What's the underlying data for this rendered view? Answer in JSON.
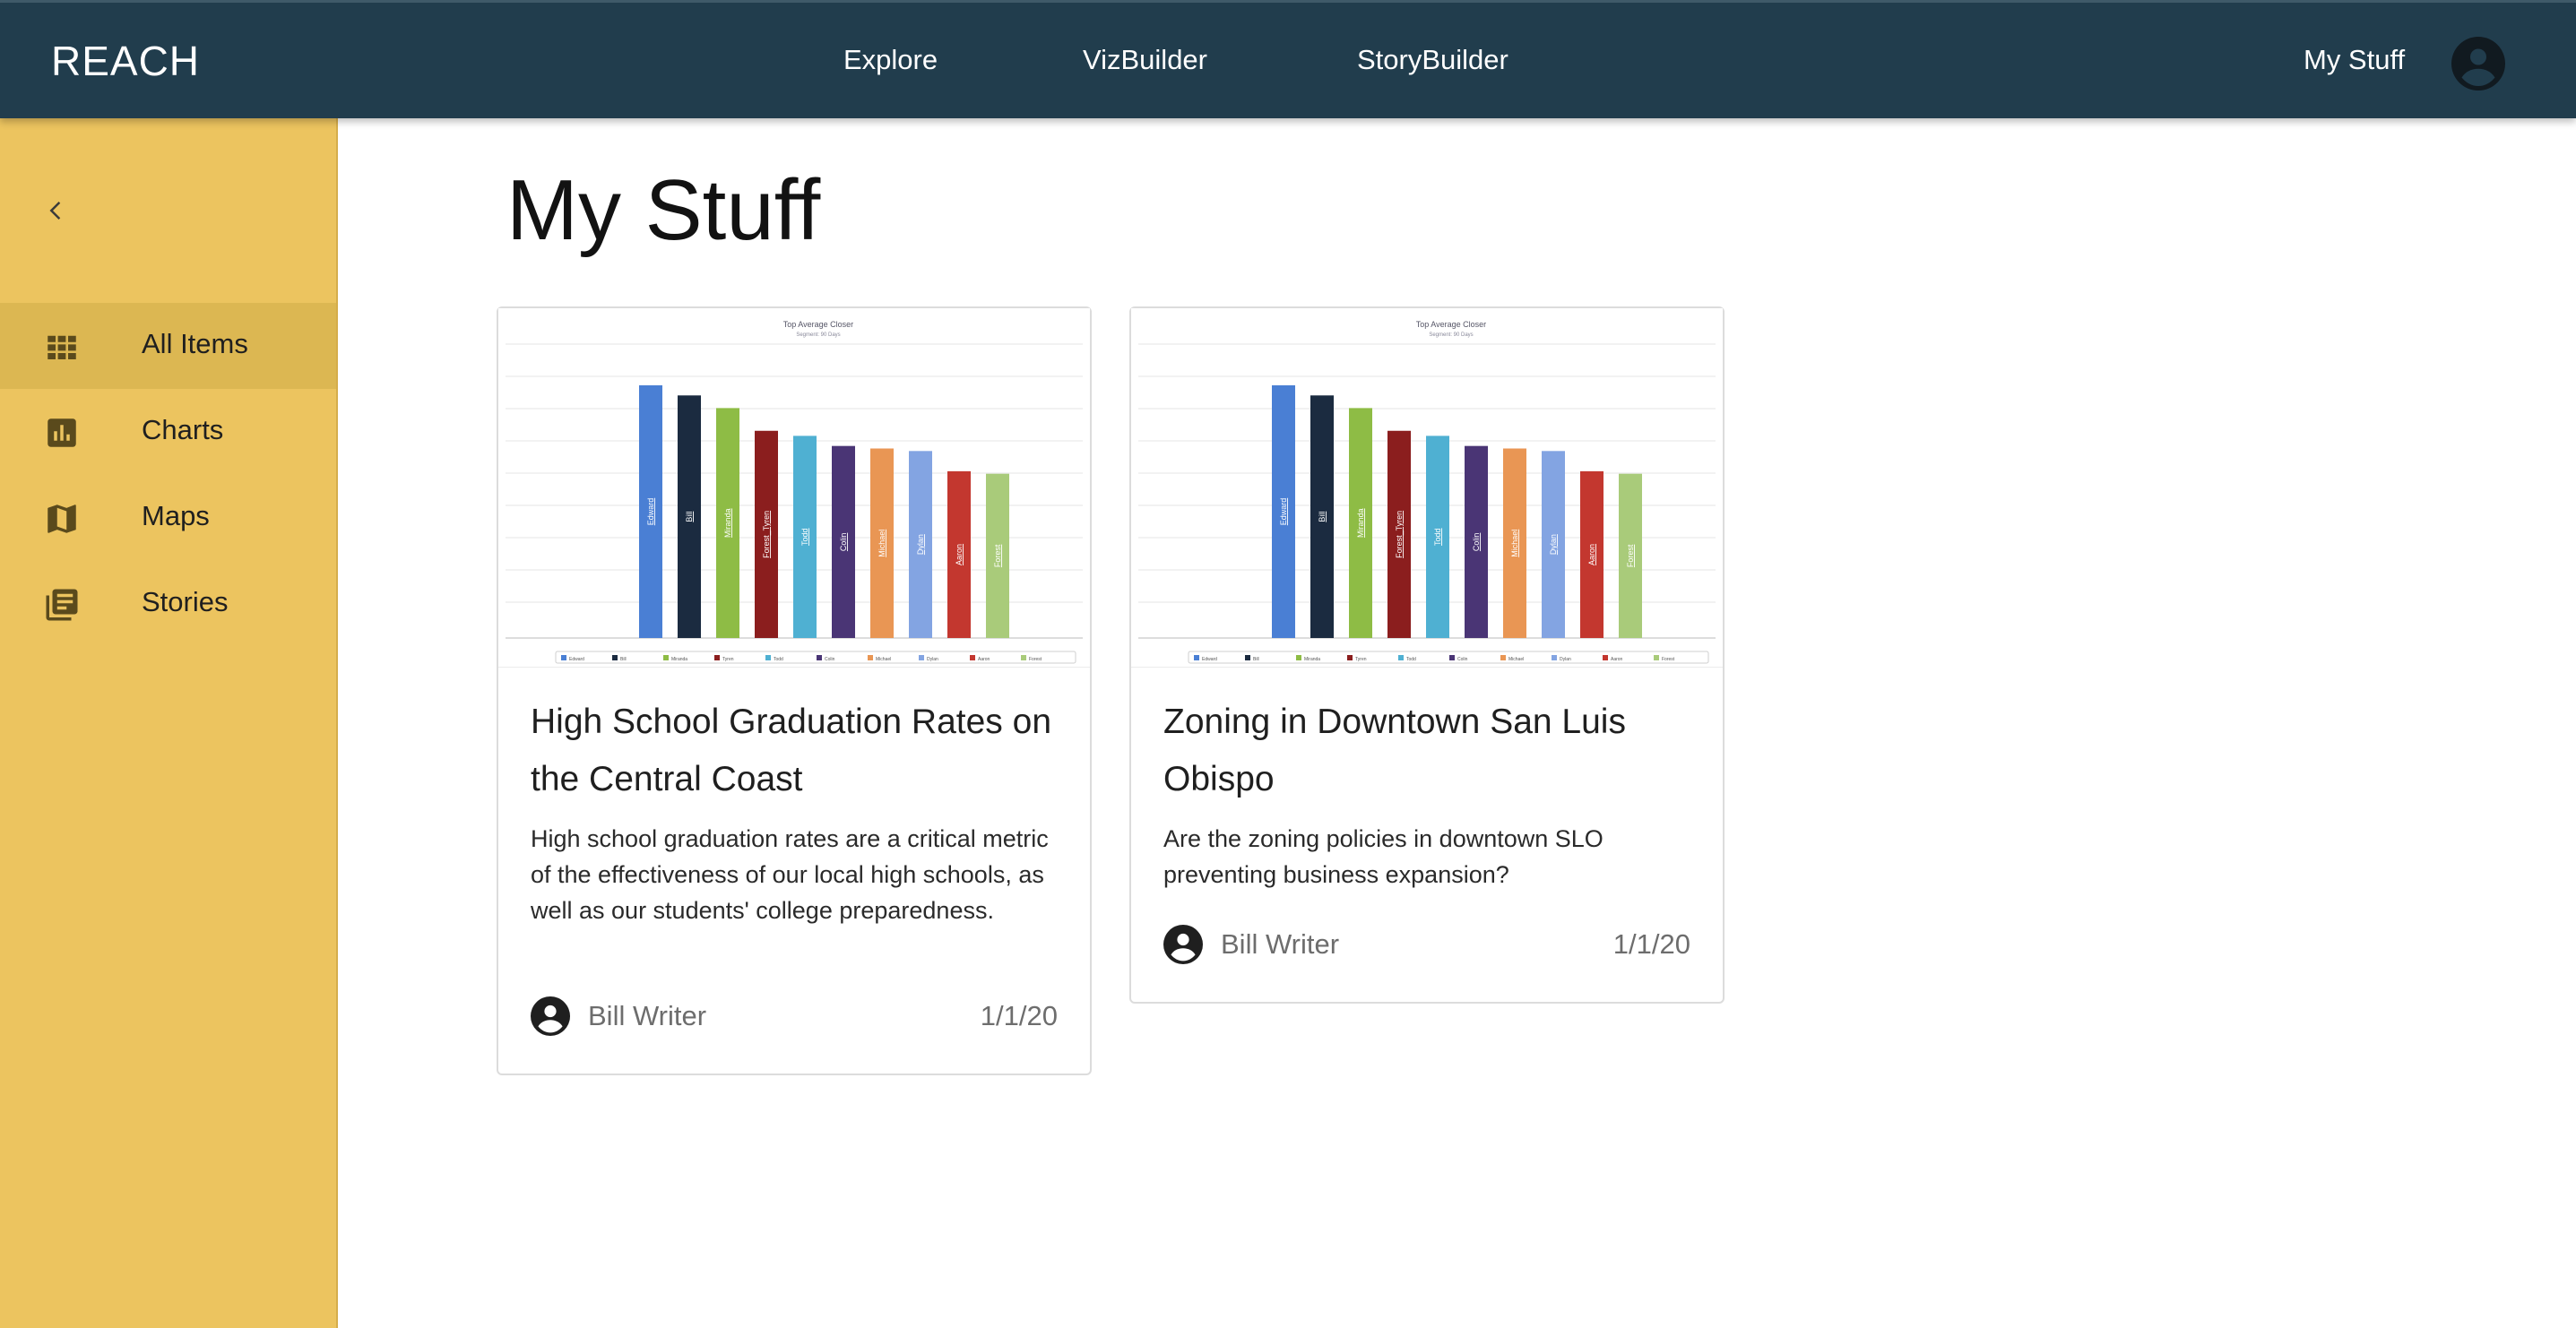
{
  "header": {
    "logo": "REACH",
    "nav": [
      "Explore",
      "VizBuilder",
      "StoryBuilder"
    ],
    "my_stuff": "My Stuff"
  },
  "sidebar": {
    "items": [
      {
        "label": "All Items",
        "icon": "grid-icon",
        "active": true
      },
      {
        "label": "Charts",
        "icon": "bar-chart-icon",
        "active": false
      },
      {
        "label": "Maps",
        "icon": "map-icon",
        "active": false
      },
      {
        "label": "Stories",
        "icon": "stories-icon",
        "active": false
      }
    ]
  },
  "main": {
    "title": "My Stuff",
    "cards": [
      {
        "title": "High School Graduation Rates on the Central Coast",
        "description": "High school graduation rates are a critical metric of the effectiveness of our local high schools, as well as our students' college preparedness.",
        "author": "Bill Writer",
        "date": "1/1/20"
      },
      {
        "title": "Zoning in Downtown San Luis Obispo",
        "description": "Are the zoning policies in downtown SLO preventing business expansion?",
        "author": "Bill Writer",
        "date": "1/1/20"
      }
    ]
  },
  "thumbnail_chart": {
    "title": "Top Average Closer",
    "subtitle": "Segment: 90 Days",
    "categories": [
      "Edward",
      "Bill",
      "Miranda",
      "Forest_Tyren",
      "Todd",
      "Colin",
      "Michael",
      "Dylan",
      "Aaron",
      "Forest"
    ],
    "legend": [
      "Edward",
      "Bill",
      "Miranda",
      "Tyren",
      "Todd",
      "Colin",
      "Michael",
      "Dylan",
      "Aaron",
      "Forest"
    ],
    "values": [
      100,
      96,
      91,
      82,
      80,
      76,
      75,
      74,
      66,
      65
    ],
    "colors": [
      "#4a7fd4",
      "#1b2b40",
      "#8ebc45",
      "#8b1e1e",
      "#4fb0d2",
      "#4a3575",
      "#e99654",
      "#83a4e2",
      "#c3372f",
      "#a9cb7a"
    ]
  },
  "colors": {
    "topbar": "#213d4d",
    "sidebar": "#ecc45f",
    "sidebar_active": "#dcb752"
  }
}
